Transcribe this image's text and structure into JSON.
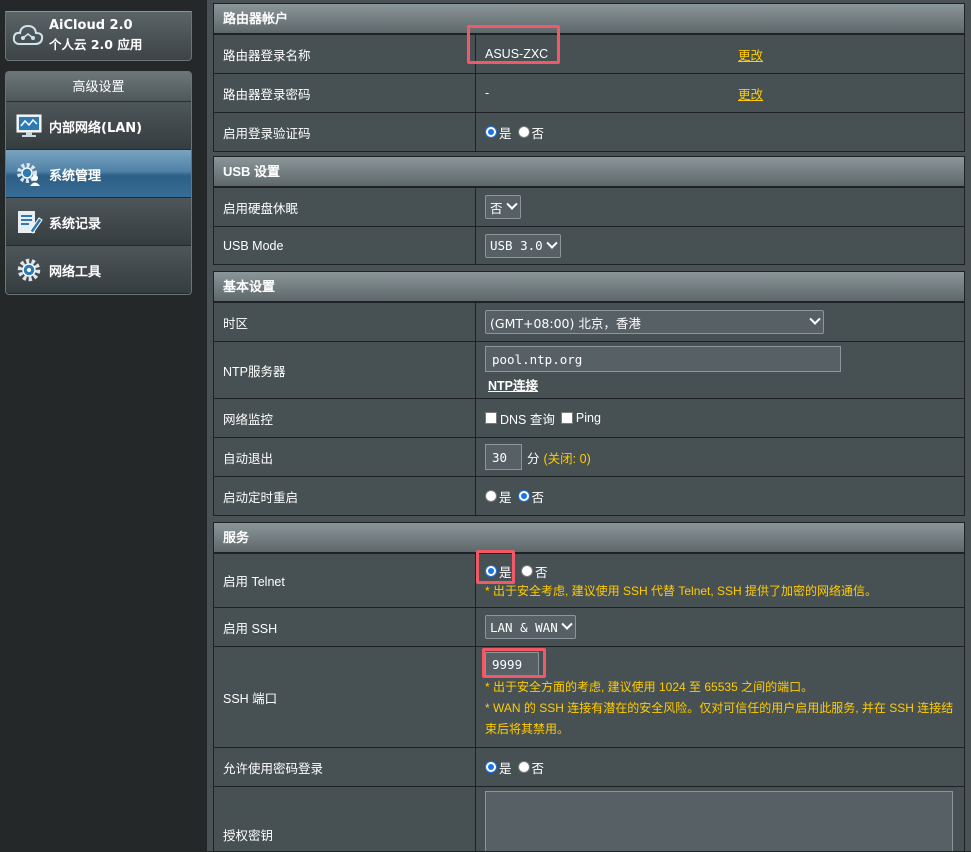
{
  "sidebar": {
    "aicloud": {
      "title": "AiCloud 2.0",
      "subtitle": "个人云 2.0 应用",
      "icon": "cloud-icon"
    },
    "advanced_title": "高级设置",
    "items": [
      {
        "label": "内部网络(LAN)",
        "icon": "lan-monitor-icon",
        "active": false
      },
      {
        "label": "系统管理",
        "icon": "gear-person-icon",
        "active": true
      },
      {
        "label": "系统记录",
        "icon": "log-list-icon",
        "active": false
      },
      {
        "label": "网络工具",
        "icon": "gear-tools-icon",
        "active": false
      }
    ]
  },
  "router_account": {
    "title": "路由器帐户",
    "login_name_label": "路由器登录名称",
    "login_name_value": "ASUS-ZXC",
    "login_name_change": "更改",
    "password_label": "路由器登录密码",
    "password_value": "-",
    "password_change": "更改",
    "captcha_label": "启用登录验证码",
    "yes": "是",
    "no": "否"
  },
  "usb": {
    "title": "USB 设置",
    "hdd_sleep_label": "启用硬盘休眠",
    "hdd_sleep_value": "否",
    "usb_mode_label": "USB Mode",
    "usb_mode_value": "USB 3.0"
  },
  "basic": {
    "title": "基本设置",
    "timezone_label": "时区",
    "timezone_value": "(GMT+08:00) 北京，香港",
    "ntp_label": "NTP服务器",
    "ntp_value": "pool.ntp.org",
    "ntp_link": "NTP连接",
    "monitor_label": "网络监控",
    "dns_query": "DNS 查询",
    "ping": "Ping",
    "autologout_label": "自动退出",
    "autologout_value": "30",
    "autologout_unit": "分",
    "autologout_hint": "(关闭: 0)",
    "reboot_label": "启动定时重启",
    "yes": "是",
    "no": "否"
  },
  "service": {
    "title": "服务",
    "telnet_label": "启用 Telnet",
    "yes": "是",
    "no": "否",
    "telnet_warn": "* 出于安全考虑, 建议使用 SSH 代替 Telnet, SSH 提供了加密的网络通信。",
    "ssh_label": "启用 SSH",
    "ssh_value": "LAN & WAN",
    "ssh_port_label": "SSH 端口",
    "ssh_port_value": "9999",
    "ssh_port_warn1": "* 出于安全方面的考虑, 建议使用 1024 至 65535 之间的端口。",
    "ssh_port_warn2": "* WAN 的 SSH 连接有潜在的安全风险。仅对可信任的用户启用此服务, 并在 SSH 连接结束后将其禁用。",
    "pwd_login_label": "允许使用密码登录",
    "auth_key_label": "授权密钥"
  }
}
